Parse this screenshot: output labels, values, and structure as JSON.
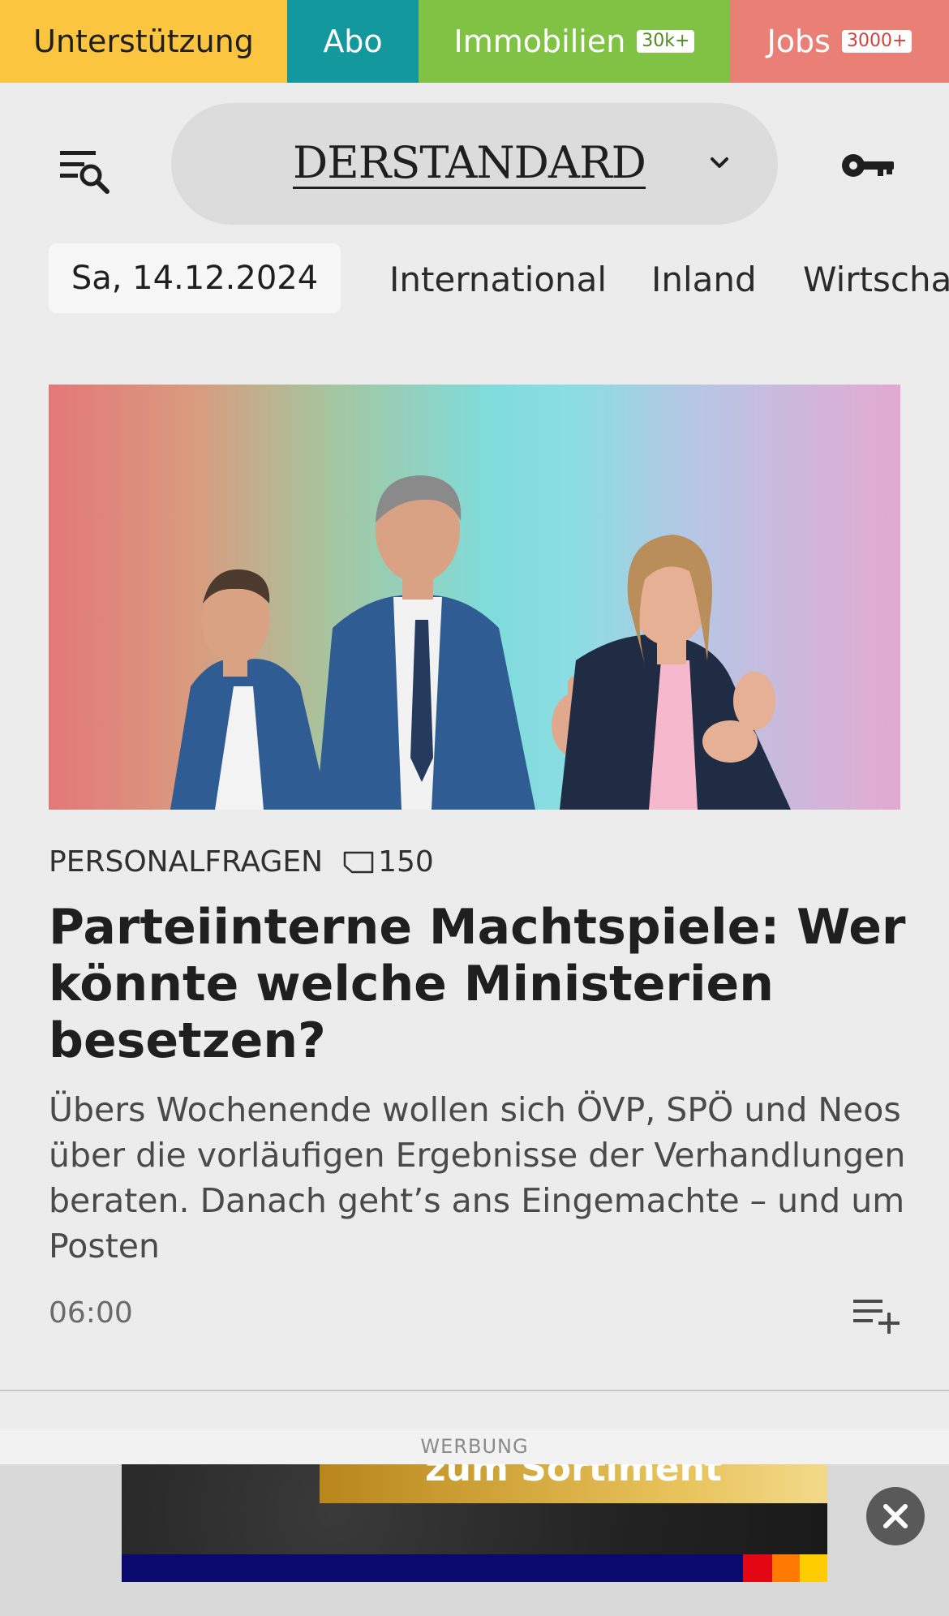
{
  "top_tabs": {
    "support": "Unterstützung",
    "abo": "Abo",
    "immobilien": {
      "label": "Immobilien",
      "badge": "30k+"
    },
    "jobs": {
      "label": "Jobs",
      "badge": "3000+"
    }
  },
  "header": {
    "logo": "DERSTANDARD"
  },
  "nav": {
    "date": "Sa, 14.12.2024",
    "items": [
      "International",
      "Inland",
      "Wirtschaft"
    ]
  },
  "article": {
    "kicker": "PERSONALFRAGEN",
    "comment_count": "150",
    "headline": "Parteiinterne Machtspiele: Wer könnte welche Ministerien besetzen?",
    "teaser": "Übers Wochenende wollen sich ÖVP, SPÖ und Neos über die vorläufigen Ergebnisse der Verhandlungen beraten. Danach geht’s ans Eingemachte – und um Posten",
    "time": "06:00"
  },
  "ad": {
    "label": "WERBUNG",
    "cta": "zum Sortiment",
    "stripe_colors": [
      "#0a0a6e",
      "#e30613",
      "#ff7a00",
      "#ffcc00"
    ]
  },
  "icons": {
    "menu": "menu-search-icon",
    "chevron": "chevron-down-icon",
    "key": "key-icon",
    "comment": "comment-icon",
    "playlist": "playlist-add-icon",
    "close": "close-icon"
  }
}
